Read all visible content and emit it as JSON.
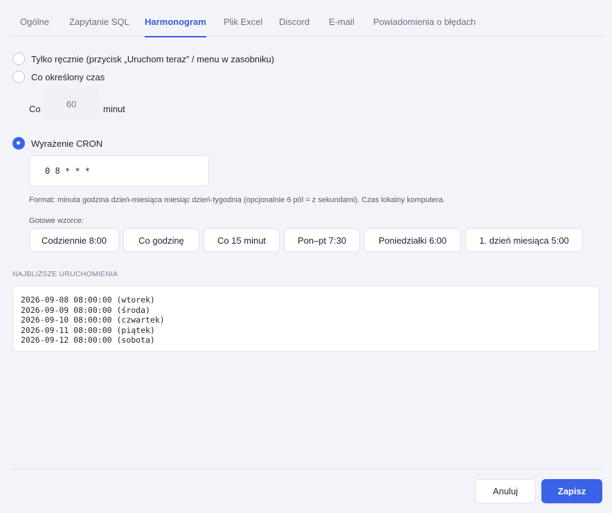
{
  "tabs": [
    {
      "label": "Ogólne"
    },
    {
      "label": "Zapytanie SQL"
    },
    {
      "label": "Harmonogram"
    },
    {
      "label": "Plik Excel"
    },
    {
      "label": "Discord"
    },
    {
      "label": "E-mail"
    },
    {
      "label": "Powiadomienia o błędach"
    }
  ],
  "active_tab": "Harmonogram",
  "schedule": {
    "options": [
      {
        "label": "Tylko ręcznie (przycisk „Uruchom teraz” / menu w zasobniku)",
        "checked": false
      },
      {
        "label": "Co określony czas",
        "checked": false
      },
      {
        "label": "Wyrażenie CRON",
        "checked": true
      }
    ],
    "interval": {
      "prefix": "Co",
      "placeholder": "60",
      "suffix": "minut"
    },
    "cron": {
      "value": "0 8 * * *"
    },
    "format_hint": "Format: minuta godzina dzień-miesiąca miesiąc dzień-tygodnia (opcjonalnie 6 pól = z sekundami). Czas lokalny komputera.",
    "presets_label": "Gotowe wzorce:",
    "presets": [
      "Codziennie 8:00",
      "Co godzinę",
      "Co 15 minut",
      "Pon–pt 7:30",
      "Poniedziałki 6:00",
      "1. dzień miesiąca 5:00"
    ]
  },
  "next_runs": {
    "title": "Najbliższe uruchomienia",
    "lines": [
      "2026-09-08 08:00:00 (wtorek)",
      "2026-09-09 08:00:00 (środa)",
      "2026-09-10 08:00:00 (czwartek)",
      "2026-09-11 08:00:00 (piątek)",
      "2026-09-12 08:00:00 (sobota)"
    ]
  },
  "footer": {
    "cancel_label": "Anuluj",
    "save_label": "Zapisz"
  },
  "colors": {
    "accent": "#3b63e8",
    "background": "#f3f4f9"
  }
}
